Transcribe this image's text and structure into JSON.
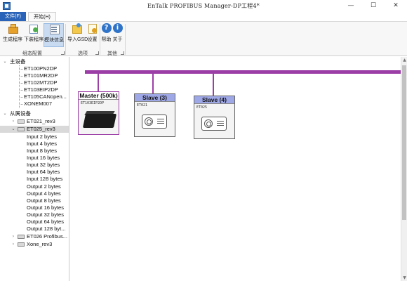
{
  "window": {
    "title": "EnTalk PROFIBUS Manager-DP工程4*",
    "minimize": "—",
    "maximize": "☐",
    "close": "✕"
  },
  "ribbon_tabs": [
    {
      "label": "文件(F)"
    },
    {
      "label": "开始(H)"
    }
  ],
  "ribbon": {
    "buttons": [
      {
        "label": "生成程序",
        "icon": "build-program-icon"
      },
      {
        "label": "下装程序",
        "icon": "download-program-icon"
      },
      {
        "label": "模块信息",
        "icon": "module-info-icon"
      },
      {
        "label": "导入GSD",
        "icon": "import-gsd-icon"
      },
      {
        "label": "设置",
        "icon": "settings-icon"
      },
      {
        "label": "帮助",
        "icon": "help-icon",
        "glyph": "?"
      },
      {
        "label": "关于",
        "icon": "about-icon",
        "glyph": "i"
      }
    ],
    "groups": [
      {
        "label": "组态配置"
      },
      {
        "label": "选项"
      },
      {
        "label": "其他"
      }
    ]
  },
  "tree": {
    "master_header": "主设备",
    "master_items": [
      "ET100PN2DP",
      "ET101MR2DP",
      "ET102MT2DP",
      "ET103EIP2DP",
      "ET105CANopen...",
      "XONEM007"
    ],
    "slave_header": "从属设备",
    "slaves": [
      {
        "label": "ET021_rev3",
        "expanded": false
      },
      {
        "label": "ET025_rev3",
        "expanded": true,
        "selected": true,
        "children": [
          "Input 2 bytes",
          "Input 4 bytes",
          "Input 8 bytes",
          "Input 16 bytes",
          "Input 32 bytes",
          "Input 64 bytes",
          "Input 128 bytes",
          "Output 2 bytes",
          "Output 4 bytes",
          "Output 8 bytes",
          "Output 16 bytes",
          "Output 32 bytes",
          "Output 64 bytes",
          "Output 128 byt..."
        ]
      },
      {
        "label": "ET026 Profibus...",
        "expanded": false
      },
      {
        "label": "Xone_rev3",
        "expanded": false
      }
    ]
  },
  "canvas": {
    "bus_color": "#9b3ea6",
    "devices": [
      {
        "title": "Master (500k)",
        "model": "ET103EIP2DP",
        "kind": "master"
      },
      {
        "title": "Slave (3)",
        "model": "ET021",
        "kind": "slave"
      },
      {
        "title": "Slave (4)",
        "model": "ET025",
        "kind": "slave"
      }
    ]
  },
  "colors": {
    "file_tab": "#2b63b8",
    "active_button": "#c9dbf1",
    "slave_header": "#9fa8e6",
    "selected_row": "#d9d9d9"
  }
}
